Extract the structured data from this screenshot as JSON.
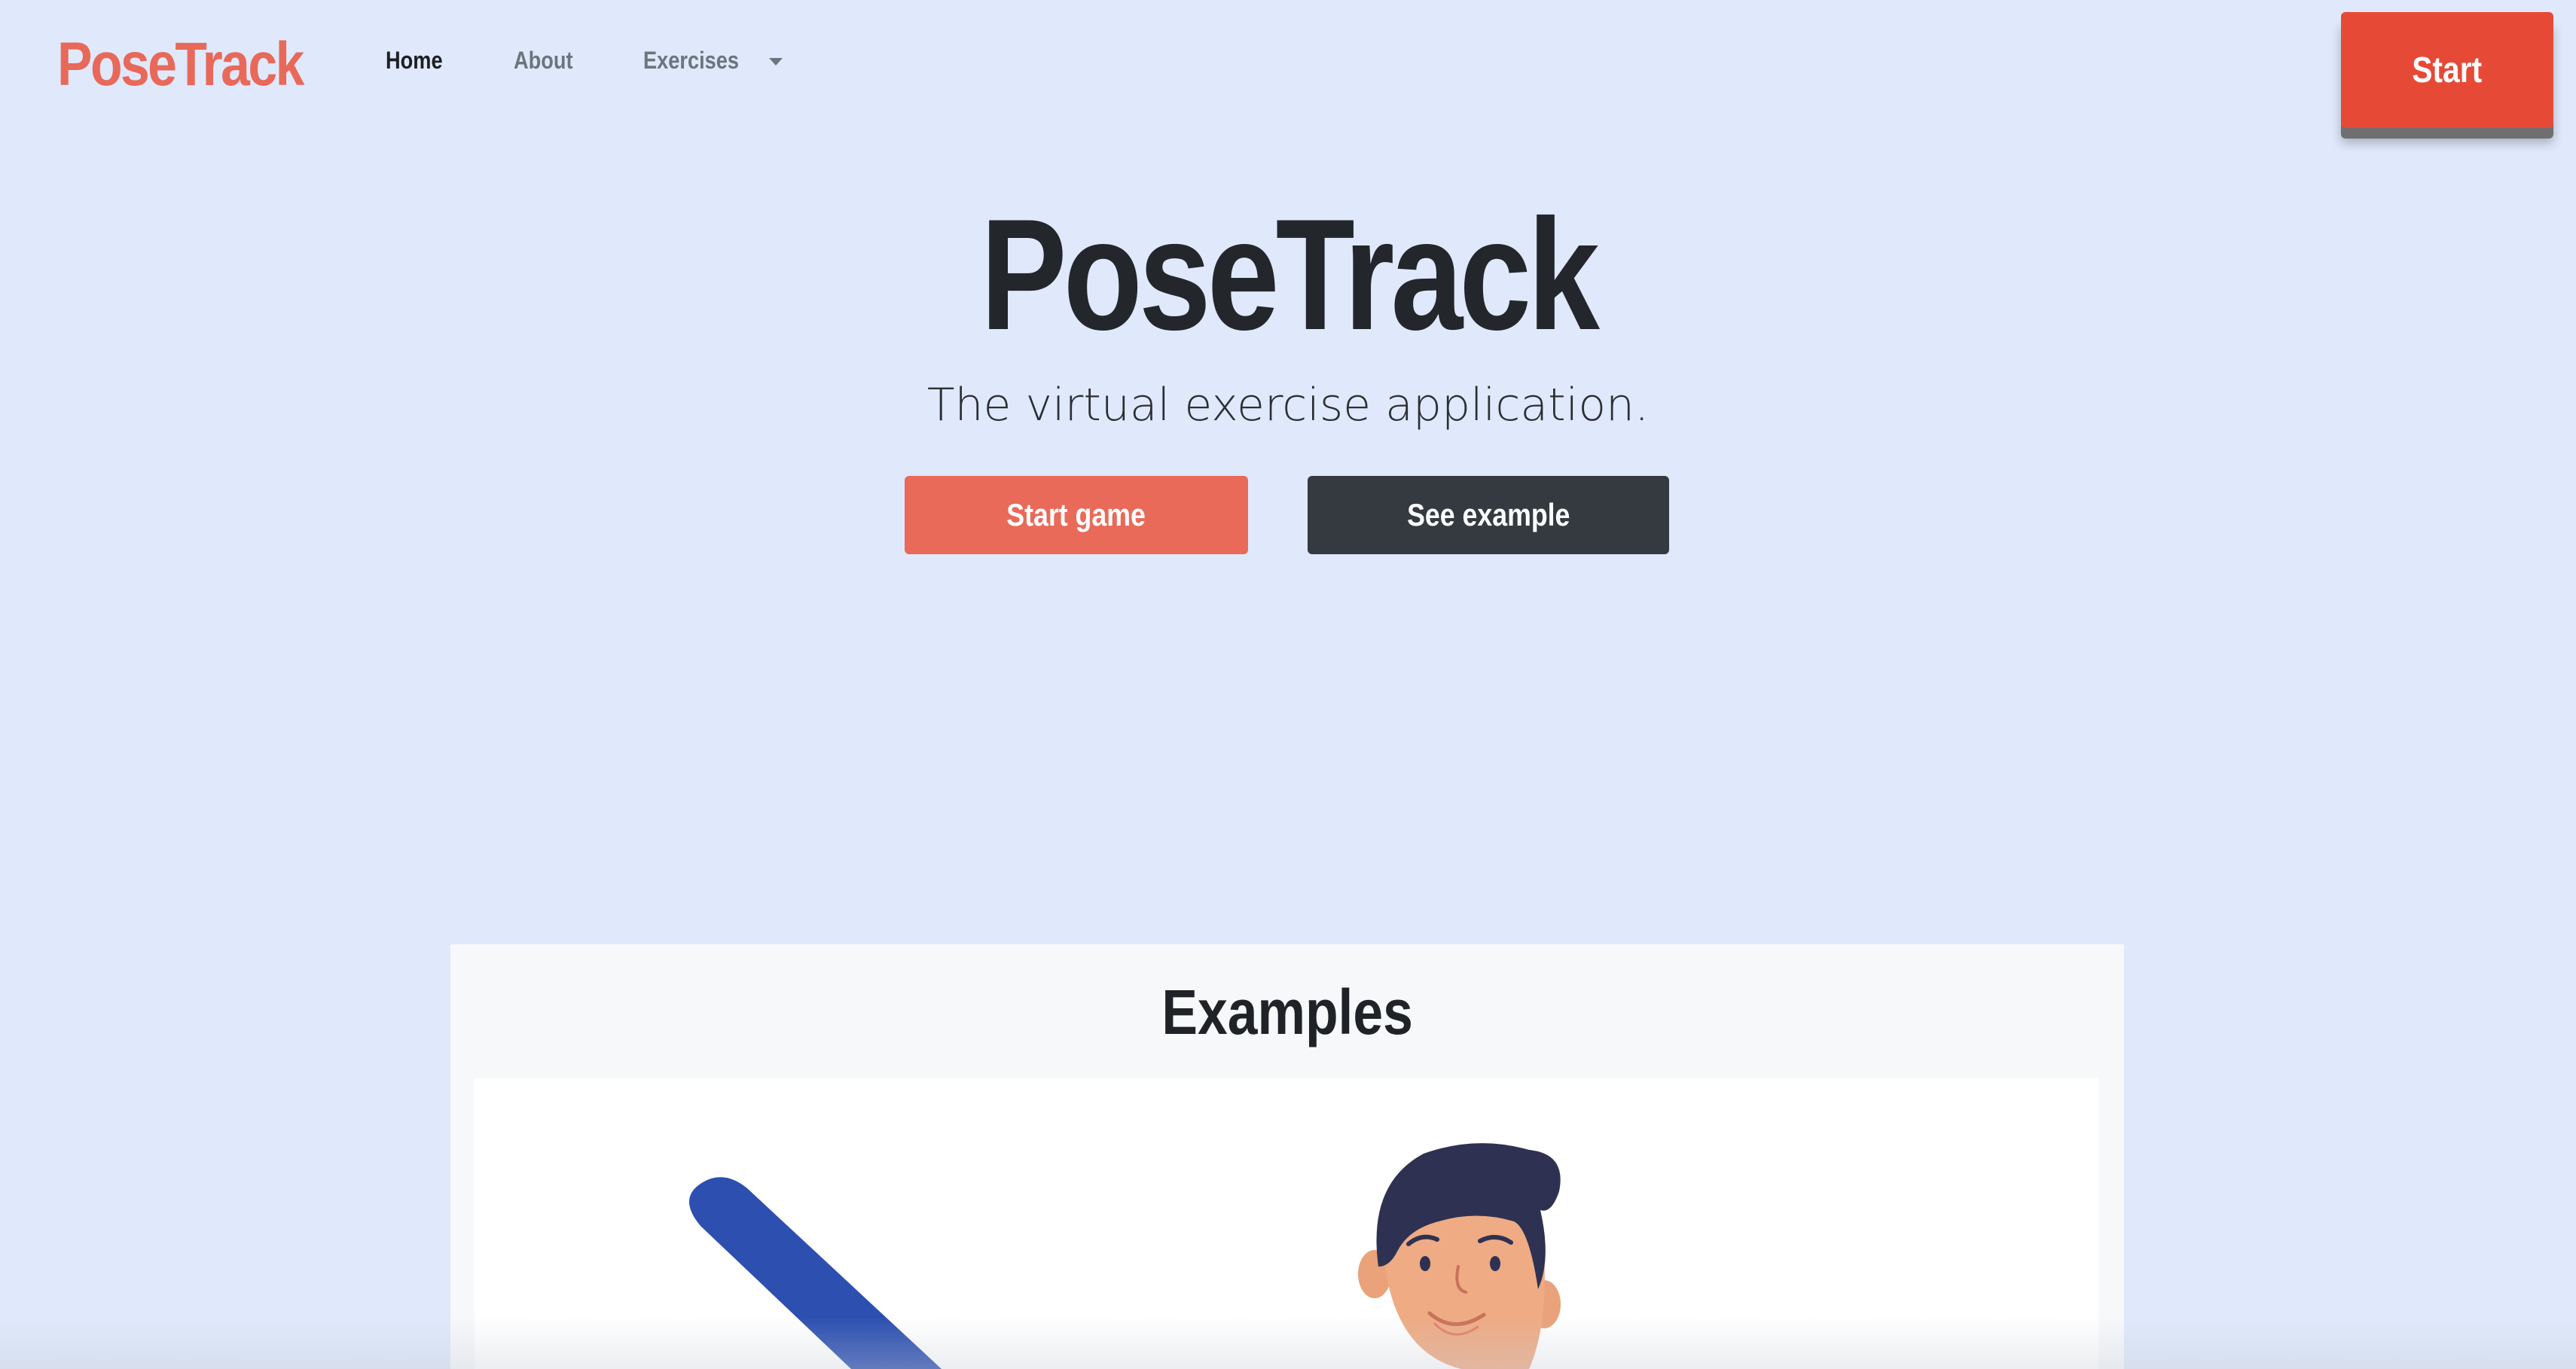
{
  "navbar": {
    "brand": "PoseTrack",
    "links": [
      {
        "label": "Home",
        "active": true
      },
      {
        "label": "About",
        "active": false
      },
      {
        "label": "Exercises",
        "active": false,
        "dropdown": true
      }
    ],
    "start_button": "Start"
  },
  "hero": {
    "title": "PoseTrack",
    "subtitle": "The virtual exercise application.",
    "buttons": {
      "start_game": "Start game",
      "see_example": "See example"
    }
  },
  "examples": {
    "title": "Examples"
  },
  "colors": {
    "background": "#dfe9fb",
    "brand": "#e8695a",
    "start_button": "#e64a36",
    "start_game_button": "#e96a59",
    "see_example_button": "#343a40",
    "card": "#f6f8fa"
  }
}
